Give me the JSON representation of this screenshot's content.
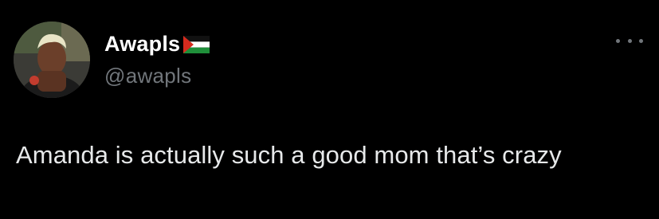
{
  "tweet": {
    "display_name": "Awapls",
    "name_emoji_icon": "palestine-flag-icon",
    "handle": "@awapls",
    "more_icon": "more-horizontal-icon",
    "text": "Amanda is actually such a good mom that’s crazy"
  },
  "colors": {
    "background": "#000000",
    "primary_text": "#e7e9ea",
    "secondary_text": "#71767b"
  }
}
